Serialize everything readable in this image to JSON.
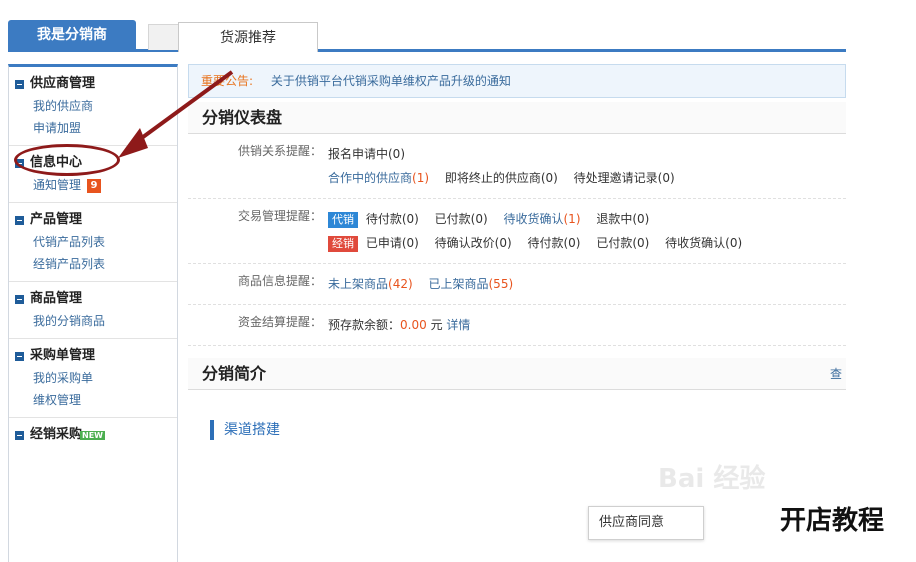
{
  "tabs": {
    "active": "我是分销商",
    "other": "货源推荐"
  },
  "sidebar": {
    "groups": [
      {
        "title": "供应商管理",
        "items": [
          "我的供应商",
          "申请加盟"
        ]
      },
      {
        "title": "信息中心",
        "items": [
          "通知管理"
        ],
        "badge": "9"
      },
      {
        "title": "产品管理",
        "items": [
          "代销产品列表",
          "经销产品列表"
        ]
      },
      {
        "title": "商品管理",
        "items": [
          "我的分销商品"
        ]
      },
      {
        "title": "采购单管理",
        "items": [
          "我的采购单",
          "维权管理"
        ]
      },
      {
        "title": "经销采购",
        "new_badge": "NEW"
      }
    ]
  },
  "notice": {
    "label": "重要公告:",
    "text": "关于供销平台代销采购单维权产品升级的通知"
  },
  "dashboard": {
    "title": "分销仪表盘",
    "supplier_label": "供销关系提醒：",
    "supplier_line1": "报名申请中(0)",
    "supplier_cooperating": "合作中的供应商",
    "supplier_cooperating_count": "(1)",
    "supplier_ending": "即将终止的供应商(0)",
    "supplier_invite": "待处理邀请记录(0)",
    "trade_label": "交易管理提醒：",
    "tag_consign": "代销",
    "trade_pay": "待付款(0)",
    "trade_paid": "已付款(0)",
    "trade_confirm": "待收货确认",
    "trade_confirm_count": "(1)",
    "trade_refund": "退款中(0)",
    "tag_dist": "经销",
    "dist_applied": "已申请(0)",
    "dist_price": "待确认改价(0)",
    "dist_pay": "待付款(0)",
    "dist_paid": "已付款(0)",
    "dist_confirm": "待收货确认(0)",
    "goods_label": "商品信息提醒：",
    "goods_unlisted": "未上架商品",
    "goods_unlisted_count": "(42)",
    "goods_listed": "已上架商品",
    "goods_listed_count": "(55)",
    "fund_label": "资金结算提醒：",
    "fund_text": "预存款余额：",
    "fund_amount": "0.00",
    "fund_unit": "元",
    "fund_detail": "详情"
  },
  "intro": {
    "title": "分销简介",
    "link": "查",
    "channel": "渠道搭建"
  },
  "popup": "供应商同意",
  "watermark": "Bai 经验",
  "overlay_text": "开店教程",
  "colors": {
    "accent": "#3c7bc2",
    "annotation": "#8e1a1a"
  }
}
